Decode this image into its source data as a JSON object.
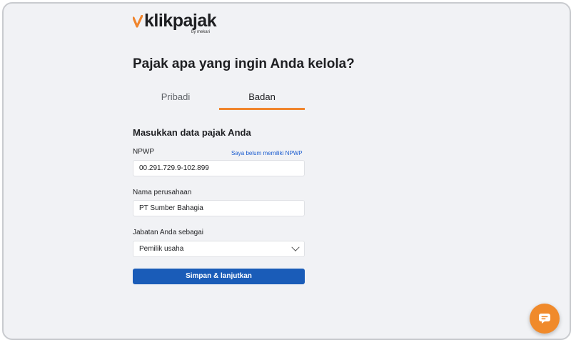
{
  "brand": {
    "name": "klikpajak",
    "tagline": "by mekari",
    "check_color": "#f0852d"
  },
  "page": {
    "heading": "Pajak apa yang ingin Anda kelola?"
  },
  "tabs": [
    {
      "label": "Pribadi",
      "active": false
    },
    {
      "label": "Badan",
      "active": true
    }
  ],
  "form": {
    "section_title": "Masukkan data pajak Anda",
    "npwp": {
      "label": "NPWP",
      "helper_link": "Saya belum memiliki NPWP",
      "value": "00.291.729.9-102.899"
    },
    "company": {
      "label": "Nama perusahaan",
      "value": "PT Sumber Bahagia"
    },
    "position": {
      "label": "Jabatan Anda sebagai",
      "value": "Pemilik usaha"
    },
    "submit_label": "Simpan & lanjutkan"
  },
  "chat_widget": {
    "icon": "chat-bubble-icon",
    "color": "#f08a2b"
  }
}
